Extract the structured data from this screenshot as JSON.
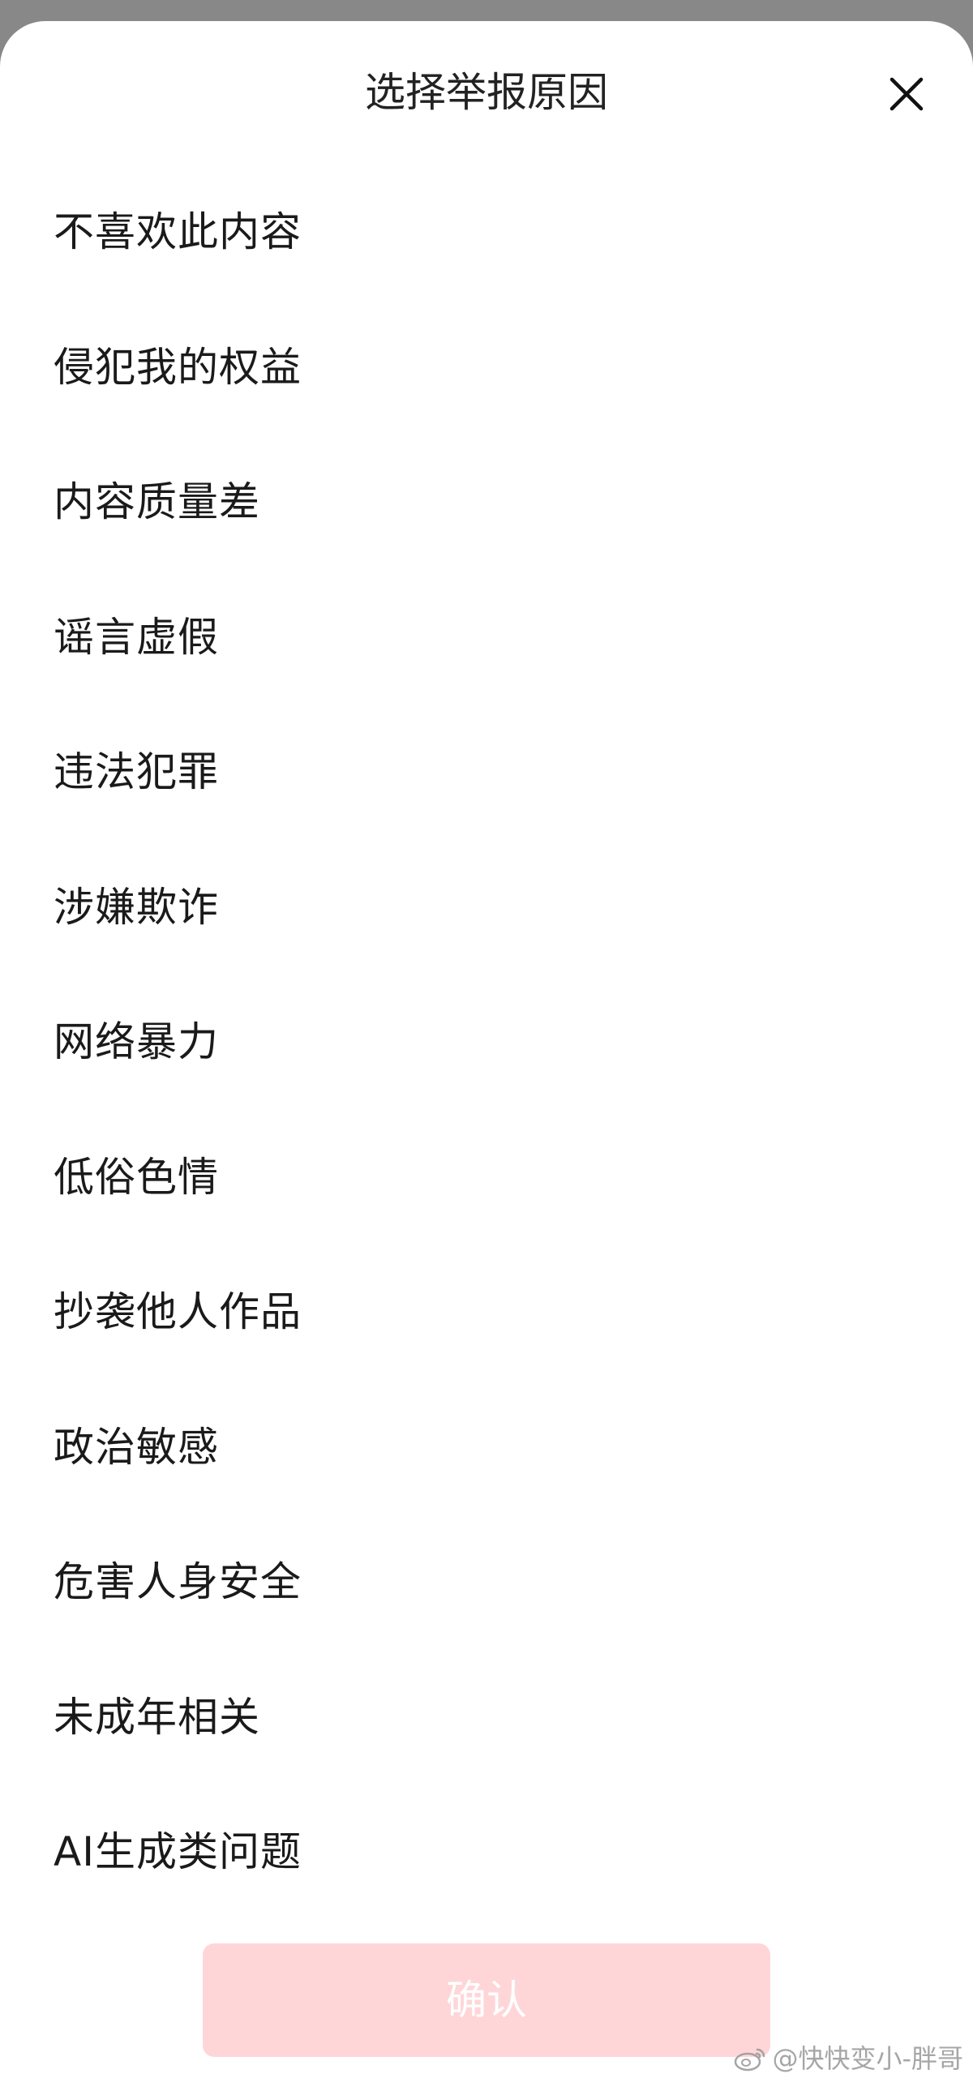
{
  "header": {
    "title": "选择举报原因",
    "close_icon": "close-icon"
  },
  "reasons": [
    {
      "label": "不喜欢此内容"
    },
    {
      "label": "侵犯我的权益"
    },
    {
      "label": "内容质量差"
    },
    {
      "label": "谣言虚假"
    },
    {
      "label": "违法犯罪"
    },
    {
      "label": "涉嫌欺诈"
    },
    {
      "label": "网络暴力"
    },
    {
      "label": "低俗色情"
    },
    {
      "label": "抄袭他人作品"
    },
    {
      "label": "政治敏感"
    },
    {
      "label": "危害人身安全"
    },
    {
      "label": "未成年相关"
    },
    {
      "label": "AI生成类问题"
    }
  ],
  "footer": {
    "confirm_label": "确认"
  },
  "watermark": {
    "text": "@快快变小-胖哥",
    "icon": "weibo-logo-icon"
  },
  "colors": {
    "overlay": "#888888",
    "sheet_bg": "#ffffff",
    "confirm_bg_disabled": "#ffd6d8",
    "confirm_text": "#ffffff",
    "text_primary": "#1a1a1a"
  }
}
